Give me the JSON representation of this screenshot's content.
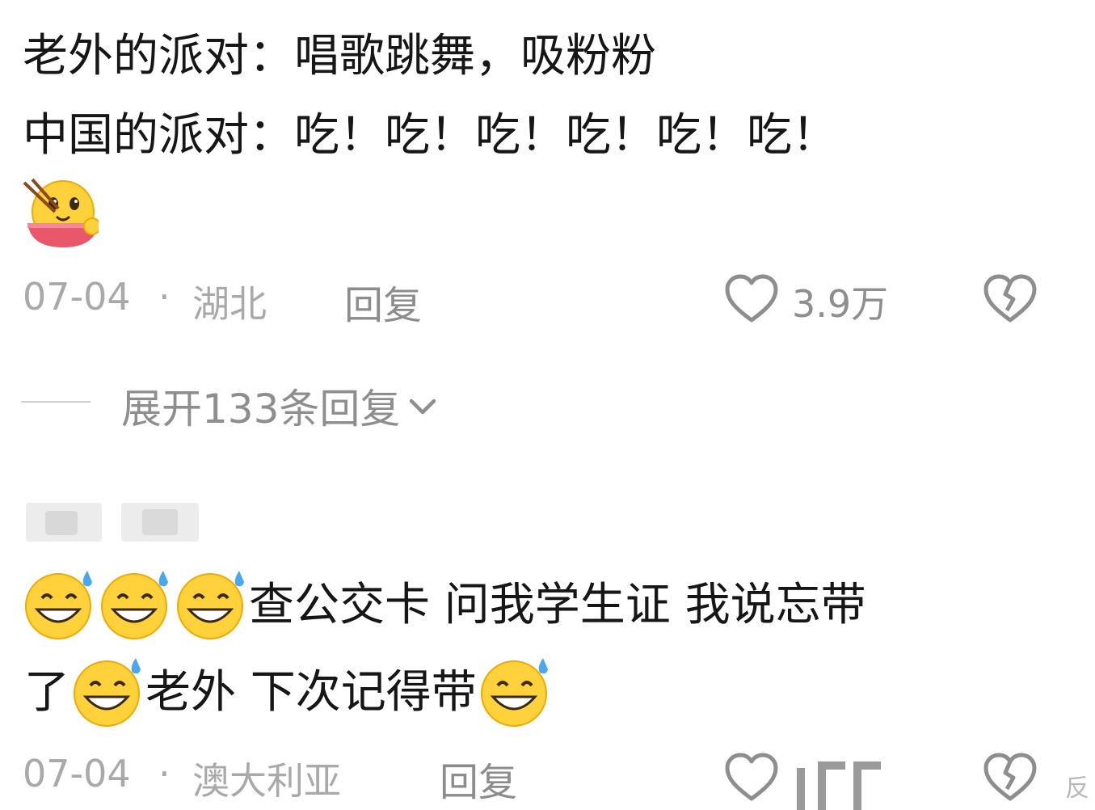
{
  "comments": [
    {
      "line1": "老外的派对：唱歌跳舞，吸粉粉",
      "line2": "中国的派对：吃！吃！吃！吃！吃！吃！",
      "emoji": "eating-noodles-emoji",
      "date": "07-04",
      "separator": "·",
      "location": "湖北",
      "reply_label": "回复",
      "likes": "3.9万",
      "expand_label": "展开133条回复"
    },
    {
      "line1_text": "查公交卡 问我学生证 我说忘带",
      "line2_part1": "了",
      "line2_part2": "老外 下次记得带",
      "emoji": "sweat-grin-emoji",
      "date": "07-04",
      "separator": "·",
      "location": "澳大利亚",
      "reply_label": "回复"
    }
  ],
  "watermark": "反",
  "colors": {
    "text": "#161616",
    "meta": "#a9a9a9",
    "icon": "#8e8e8e",
    "emoji_yellow": "#ffd13b"
  }
}
